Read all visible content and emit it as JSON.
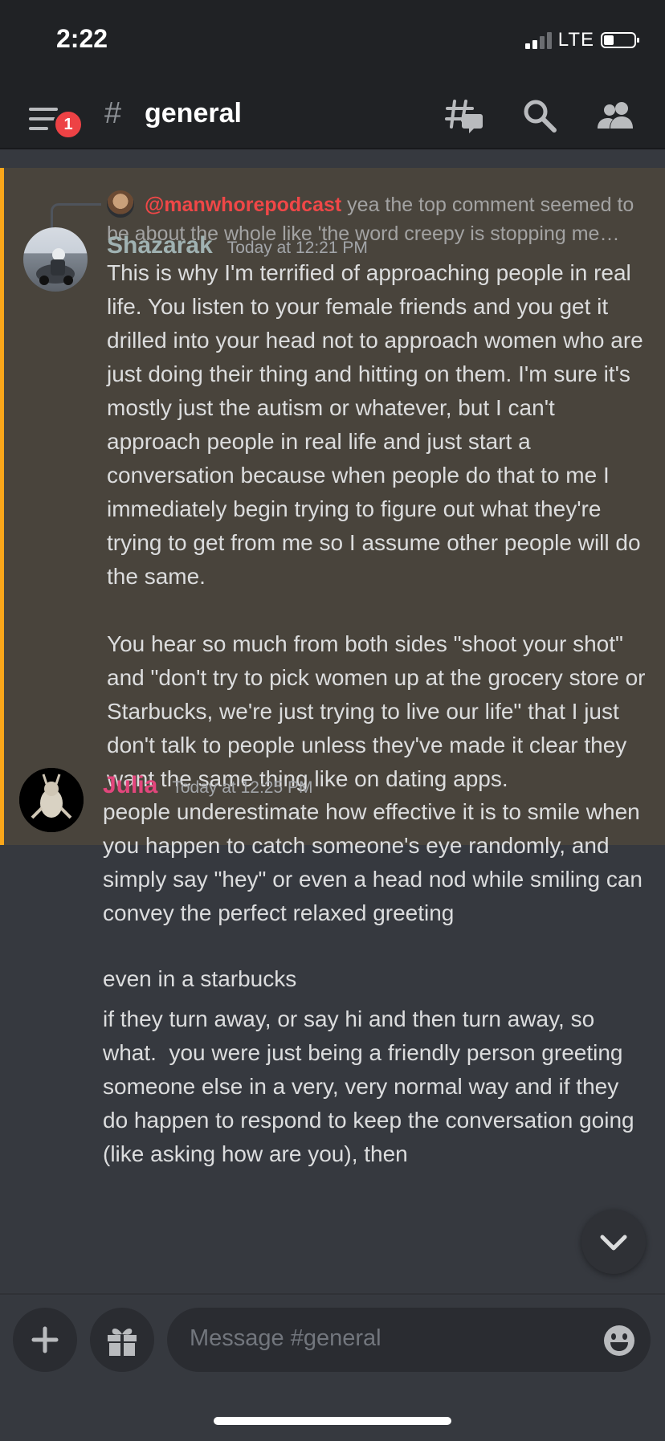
{
  "status_bar": {
    "time": "2:22",
    "network": "LTE"
  },
  "header": {
    "channel": "general",
    "notification_count": "1"
  },
  "reply_preview": {
    "mention": "@manwhorepodcast",
    "text": "yea the top comment seemed to be about the whole like 'the word creepy is stopping me…"
  },
  "messages": [
    {
      "user": "Shazarak",
      "user_color": "#a0b2b2",
      "time": "Today at 12:21 PM",
      "body": "This is why I'm terrified of approaching people in real life. You listen to your female friends and you get it drilled into your head not to approach women who are just doing their thing and hitting on them. I'm sure it's mostly just the autism or whatever, but I can't approach people in real life and just start a conversation because when people do that to me I immediately begin trying to figure out what they're trying to get from me so I assume other people will do the same.\n\nYou hear so much from both sides \"shoot your shot\" and \"don't try to pick women up at the grocery store or Starbucks, we're just trying to live our life\" that I just don't talk to people unless they've made it clear they want the same thing like on dating apps."
    },
    {
      "user": "Julia",
      "user_color": "#e2467c",
      "time": "Today at 12:25 PM",
      "body1": "people underestimate how effective it is to smile when you happen to catch someone's eye randomly, and simply say \"hey\" or even a head nod while smiling can convey the perfect relaxed greeting",
      "body2": "even in a starbucks",
      "body3": "if they turn away, or say hi and then turn away, so what.  you were just being a friendly person greeting someone else in a very, very normal way and if they do happen to respond to keep the conversation going (like asking how are you), then"
    }
  ],
  "composer": {
    "placeholder": "Message #general"
  },
  "colors": {
    "background": "#36393f",
    "highlight": "#49443c",
    "highlight_border": "#faa61a"
  },
  "icons": [
    "menu-icon",
    "hash-icon",
    "threads-icon",
    "search-icon",
    "members-icon",
    "chevron-down-icon",
    "plus-icon",
    "gift-icon",
    "emoji-icon"
  ]
}
